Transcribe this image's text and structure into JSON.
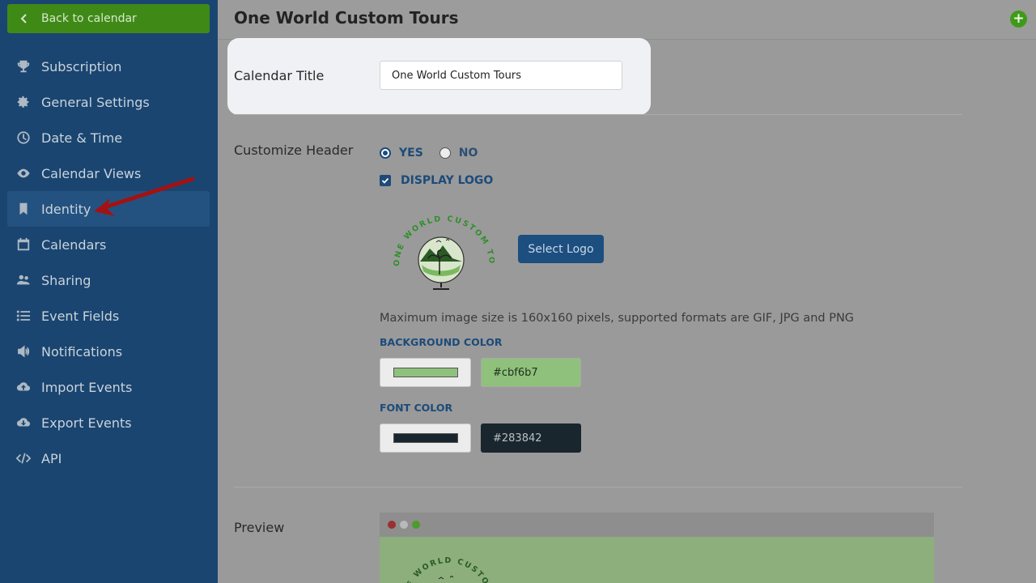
{
  "sidebar": {
    "back_label": "Back to calendar",
    "items": [
      {
        "label": "Subscription",
        "icon": "trophy-icon"
      },
      {
        "label": "General Settings",
        "icon": "gear-icon"
      },
      {
        "label": "Date & Time",
        "icon": "clock-icon"
      },
      {
        "label": "Calendar Views",
        "icon": "eye-icon"
      },
      {
        "label": "Identity",
        "icon": "bookmark-icon",
        "active": true
      },
      {
        "label": "Calendars",
        "icon": "calendar-icon"
      },
      {
        "label": "Sharing",
        "icon": "users-icon"
      },
      {
        "label": "Event Fields",
        "icon": "list-icon"
      },
      {
        "label": "Notifications",
        "icon": "megaphone-icon"
      },
      {
        "label": "Import Events",
        "icon": "cloud-upload-icon"
      },
      {
        "label": "Export Events",
        "icon": "cloud-download-icon"
      },
      {
        "label": "API",
        "icon": "code-icon"
      }
    ]
  },
  "header": {
    "title": "One World Custom Tours",
    "add_icon": "plus-circle-icon"
  },
  "form": {
    "calendar_title_label": "Calendar Title",
    "calendar_title_value": "One World Custom Tours",
    "customize_header_label": "Customize Header",
    "radio_yes": "YES",
    "radio_no": "NO",
    "display_logo_label": "DISPLAY LOGO",
    "logo_text": "ONE WORLD CUSTOM TOURS",
    "select_logo_label": "Select Logo",
    "hint": "Maximum image size is 160x160 pixels, supported formats are GIF, JPG and PNG",
    "background_color_label": "BACKGROUND COLOR",
    "background_color_value": "#cbf6b7",
    "font_color_label": "FONT COLOR",
    "font_color_value": "#283842",
    "preview_label": "Preview"
  },
  "colors": {
    "sidebar_bg": "#1a4570",
    "accent_green": "#3f8a17",
    "primary_blue": "#1c4b7a",
    "background_swatch": "#cbf6b7",
    "font_swatch": "#283842"
  }
}
